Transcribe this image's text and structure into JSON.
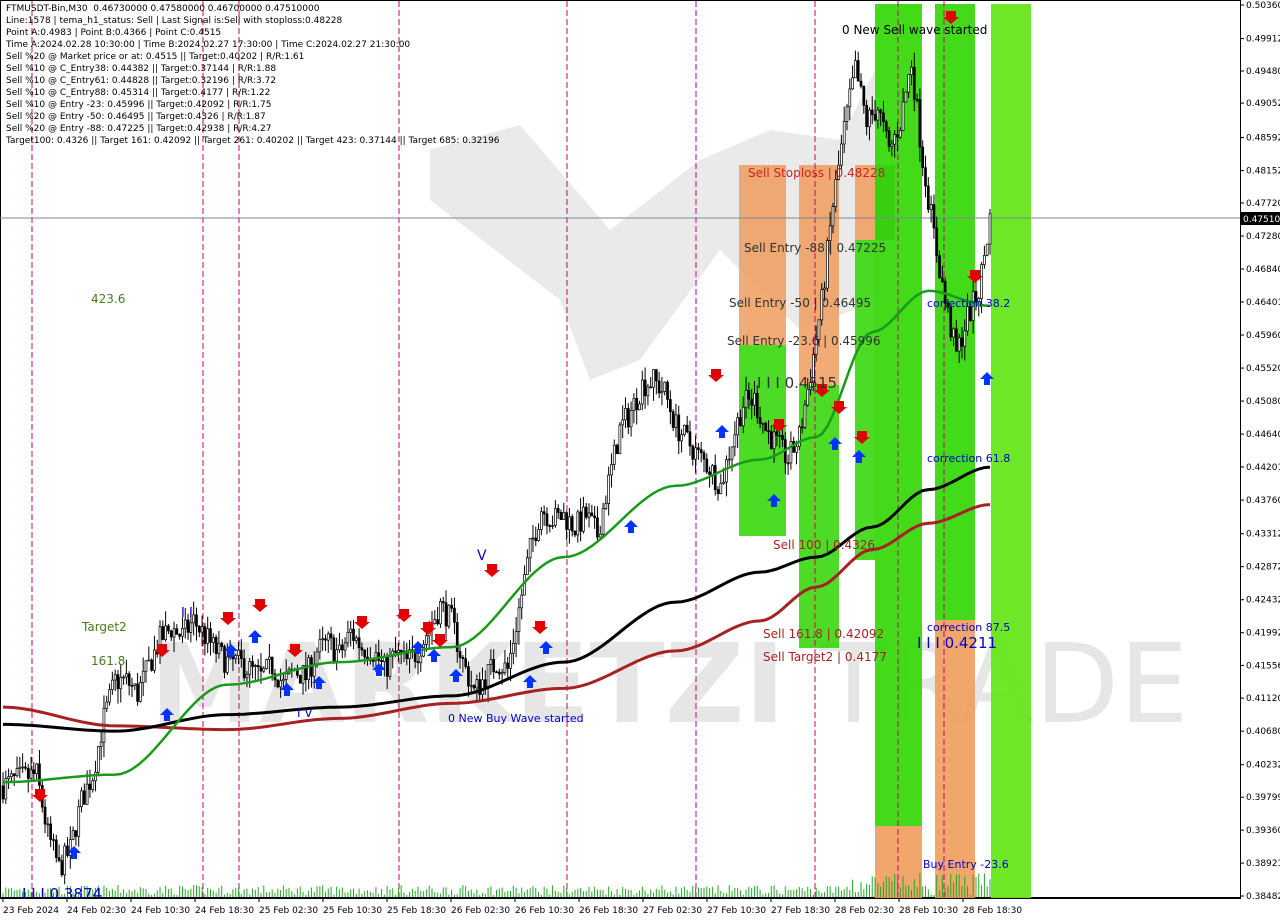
{
  "info_lines": [
    "FTMUSDT-Bin,M30  0.46730000 0.47580000 0.46700000 0.47510000",
    "Line:1578 | tema_h1_status: Sell | Last Signal is:Sell with stoploss:0.48228",
    "Point A:0.4983 | Point B:0.4366 | Point C:0.4515",
    "Time A:2024.02.28 10:30:00 | Time B:2024.02.27 17:30:00 | Time C:2024.02.27 21:30:00",
    "Sell %20 @ Market price or at: 0.4515 || Target:0.40202 | R/R:1.61",
    "Sell %10 @ C_Entry38: 0.44382 || Target:0.37144 | R/R:1.88",
    "Sell %10 @ C_Entry61: 0.44828 || Target:0.32196 | R/R:3.72",
    "Sell %10 @ C_Entry88: 0.45314 || Target:0.4177 | R/R:1.22",
    "Sell %10 @ Entry -23: 0.45996 || Target:0.42092 | R/R:1.75",
    "Sell %20 @ Entry -50: 0.46495 || Target:0.4326 | R/R:1.87",
    "Sell %20 @ Entry -88: 0.47225 || Target:0.42938 | R/R:4.27",
    "Target100: 0.4326 || Target 161: 0.42092 || Target 261: 0.40202 || Target 423: 0.37144 || Target 685: 0.32196"
  ],
  "price_labels": [
    "0.50360",
    "0.49912",
    "0.49480",
    "0.49052",
    "0.48592",
    "0.48152",
    "0.47720",
    "0.47280",
    "0.46840",
    "0.46401",
    "0.45960",
    "0.45520",
    "0.45080",
    "0.44640",
    "0.44201",
    "0.43760",
    "0.43312",
    "0.42872",
    "0.42432",
    "0.41992",
    "0.41556",
    "0.41120",
    "0.40680",
    "0.40232",
    "0.39799",
    "0.39360",
    "0.38921",
    "0.38482"
  ],
  "time_labels": [
    "23 Feb 2024",
    "24 Feb 02:30",
    "24 Feb 10:30",
    "24 Feb 18:30",
    "25 Feb 02:30",
    "25 Feb 10:30",
    "25 Feb 18:30",
    "26 Feb 02:30",
    "26 Feb 10:30",
    "26 Feb 18:30",
    "27 Feb 02:30",
    "27 Feb 10:30",
    "27 Feb 18:30",
    "28 Feb 02:30",
    "28 Feb 10:30",
    "28 Feb 18:30"
  ],
  "current_price": "0.47510",
  "annotations": {
    "new_sell_wave": "0 New Sell wave started",
    "new_buy_wave": "0 New Buy Wave started",
    "sell_stoploss": "Sell Stoploss | 0.48228",
    "sell_entry_88": "Sell Entry -88 | 0.47225",
    "sell_entry_50": "Sell Entry -50 | 0.46495",
    "sell_entry_23": "Sell Entry -23.6 | 0.45996",
    "point_c": "I I I 0.4515",
    "sell_100": "Sell 100 | 0.4326",
    "sell_161": "Sell 161.8 | 0.42092",
    "sell_target2": "Sell Target2 | 0.4177",
    "correction_382": "correction 38.2",
    "correction_618": "correction 61.8",
    "correction_875": "correction 87.5",
    "point_b": "I I I 0.4211",
    "buy_entry": "Buy Entry -23.6",
    "point_low": "I I I 0.3874",
    "left_4236": "423.6",
    "left_target2": "Target2",
    "left_1618": "161.8",
    "v_top": "V",
    "iv_bottom": "I V",
    "ii_top": "I I"
  },
  "watermark_text": "TRADE",
  "chart_data": {
    "type": "candlestick",
    "symbol": "FTMUSDT-Bin",
    "timeframe": "M30",
    "ylim": [
      0.38482,
      0.5036
    ],
    "y_ticks": [
      0.5036,
      0.49912,
      0.4948,
      0.49052,
      0.48592,
      0.48152,
      0.4772,
      0.4728,
      0.4684,
      0.46401,
      0.4596,
      0.4552,
      0.4508,
      0.4464,
      0.44201,
      0.4376,
      0.43312,
      0.42872,
      0.42432,
      0.41992,
      0.41556,
      0.4112,
      0.4068,
      0.40232,
      0.39799,
      0.3936,
      0.38921,
      0.38482
    ],
    "close_path": [
      [
        0,
        0.3995
      ],
      [
        6,
        0.4005
      ],
      [
        12,
        0.401
      ],
      [
        16,
        0.393
      ],
      [
        20,
        0.3885
      ],
      [
        24,
        0.391
      ],
      [
        28,
        0.3975
      ],
      [
        32,
        0.401
      ],
      [
        36,
        0.4085
      ],
      [
        40,
        0.4135
      ],
      [
        44,
        0.4135
      ],
      [
        48,
        0.4118
      ],
      [
        52,
        0.4155
      ],
      [
        56,
        0.419
      ],
      [
        60,
        0.4205
      ],
      [
        64,
        0.4195
      ],
      [
        68,
        0.4215
      ],
      [
        72,
        0.4195
      ],
      [
        76,
        0.4175
      ],
      [
        80,
        0.416
      ],
      [
        84,
        0.416
      ],
      [
        88,
        0.415
      ],
      [
        92,
        0.414
      ],
      [
        96,
        0.4155
      ],
      [
        100,
        0.413
      ],
      [
        104,
        0.415
      ],
      [
        108,
        0.414
      ],
      [
        112,
        0.4175
      ],
      [
        116,
        0.4185
      ],
      [
        120,
        0.417
      ],
      [
        124,
        0.42
      ],
      [
        128,
        0.418
      ],
      [
        132,
        0.4175
      ],
      [
        136,
        0.415
      ],
      [
        140,
        0.417
      ],
      [
        144,
        0.416
      ],
      [
        148,
        0.4175
      ],
      [
        152,
        0.4205
      ],
      [
        156,
        0.4235
      ],
      [
        160,
        0.4215
      ],
      [
        164,
        0.416
      ],
      [
        168,
        0.412
      ],
      [
        172,
        0.414
      ],
      [
        176,
        0.416
      ],
      [
        180,
        0.415
      ],
      [
        184,
        0.423
      ],
      [
        188,
        0.431
      ],
      [
        192,
        0.4365
      ],
      [
        196,
        0.435
      ],
      [
        200,
        0.4355
      ],
      [
        204,
        0.434
      ],
      [
        208,
        0.4355
      ],
      [
        212,
        0.433
      ],
      [
        216,
        0.44
      ],
      [
        220,
        0.447
      ],
      [
        224,
        0.4495
      ],
      [
        228,
        0.453
      ],
      [
        232,
        0.4535
      ],
      [
        236,
        0.452
      ],
      [
        240,
        0.4475
      ],
      [
        244,
        0.4455
      ],
      [
        248,
        0.4435
      ],
      [
        252,
        0.442
      ],
      [
        256,
        0.4395
      ],
      [
        260,
        0.4455
      ],
      [
        264,
        0.4505
      ],
      [
        268,
        0.451
      ],
      [
        272,
        0.447
      ],
      [
        276,
        0.445
      ],
      [
        280,
        0.443
      ],
      [
        284,
        0.446
      ],
      [
        288,
        0.4545
      ],
      [
        292,
        0.464
      ],
      [
        296,
        0.477
      ],
      [
        300,
        0.487
      ],
      [
        304,
        0.495
      ],
      [
        308,
        0.488
      ],
      [
        312,
        0.49
      ],
      [
        316,
        0.484
      ],
      [
        320,
        0.488
      ],
      [
        324,
        0.496
      ],
      [
        328,
        0.483
      ],
      [
        332,
        0.473
      ],
      [
        336,
        0.464
      ],
      [
        340,
        0.457
      ],
      [
        344,
        0.462
      ],
      [
        348,
        0.4655
      ],
      [
        352,
        0.4751
      ]
    ],
    "ma_green": [
      [
        0,
        0.4
      ],
      [
        40,
        0.401
      ],
      [
        80,
        0.413
      ],
      [
        120,
        0.416
      ],
      [
        160,
        0.418
      ],
      [
        200,
        0.43
      ],
      [
        240,
        0.4395
      ],
      [
        270,
        0.443
      ],
      [
        290,
        0.446
      ],
      [
        310,
        0.46
      ],
      [
        330,
        0.4655
      ],
      [
        352,
        0.4635
      ]
    ],
    "ma_black": [
      [
        0,
        0.4077
      ],
      [
        40,
        0.4068
      ],
      [
        80,
        0.409
      ],
      [
        120,
        0.41
      ],
      [
        160,
        0.4115
      ],
      [
        200,
        0.416
      ],
      [
        240,
        0.424
      ],
      [
        270,
        0.428
      ],
      [
        290,
        0.43
      ],
      [
        310,
        0.434
      ],
      [
        330,
        0.439
      ],
      [
        352,
        0.442
      ]
    ],
    "ma_red": [
      [
        0,
        0.41
      ],
      [
        40,
        0.4075
      ],
      [
        80,
        0.407
      ],
      [
        120,
        0.4085
      ],
      [
        160,
        0.4105
      ],
      [
        200,
        0.4125
      ],
      [
        240,
        0.4175
      ],
      [
        270,
        0.4215
      ],
      [
        290,
        0.426
      ],
      [
        310,
        0.431
      ],
      [
        330,
        0.4345
      ],
      [
        352,
        0.437
      ]
    ]
  },
  "colors": {
    "green_zone": "#2ed600",
    "bright_green": "#66e61a",
    "orange_zone": "#f09c5c",
    "gray_zone": "#8090a0",
    "ma_green": "#1a9a1a",
    "ma_black": "#000000",
    "ma_red": "#a62222",
    "magenta_line": "#cc0077",
    "blue_text": "#0000cc",
    "sell_red": "#cc0000",
    "buy_blue": "#0000ff"
  }
}
